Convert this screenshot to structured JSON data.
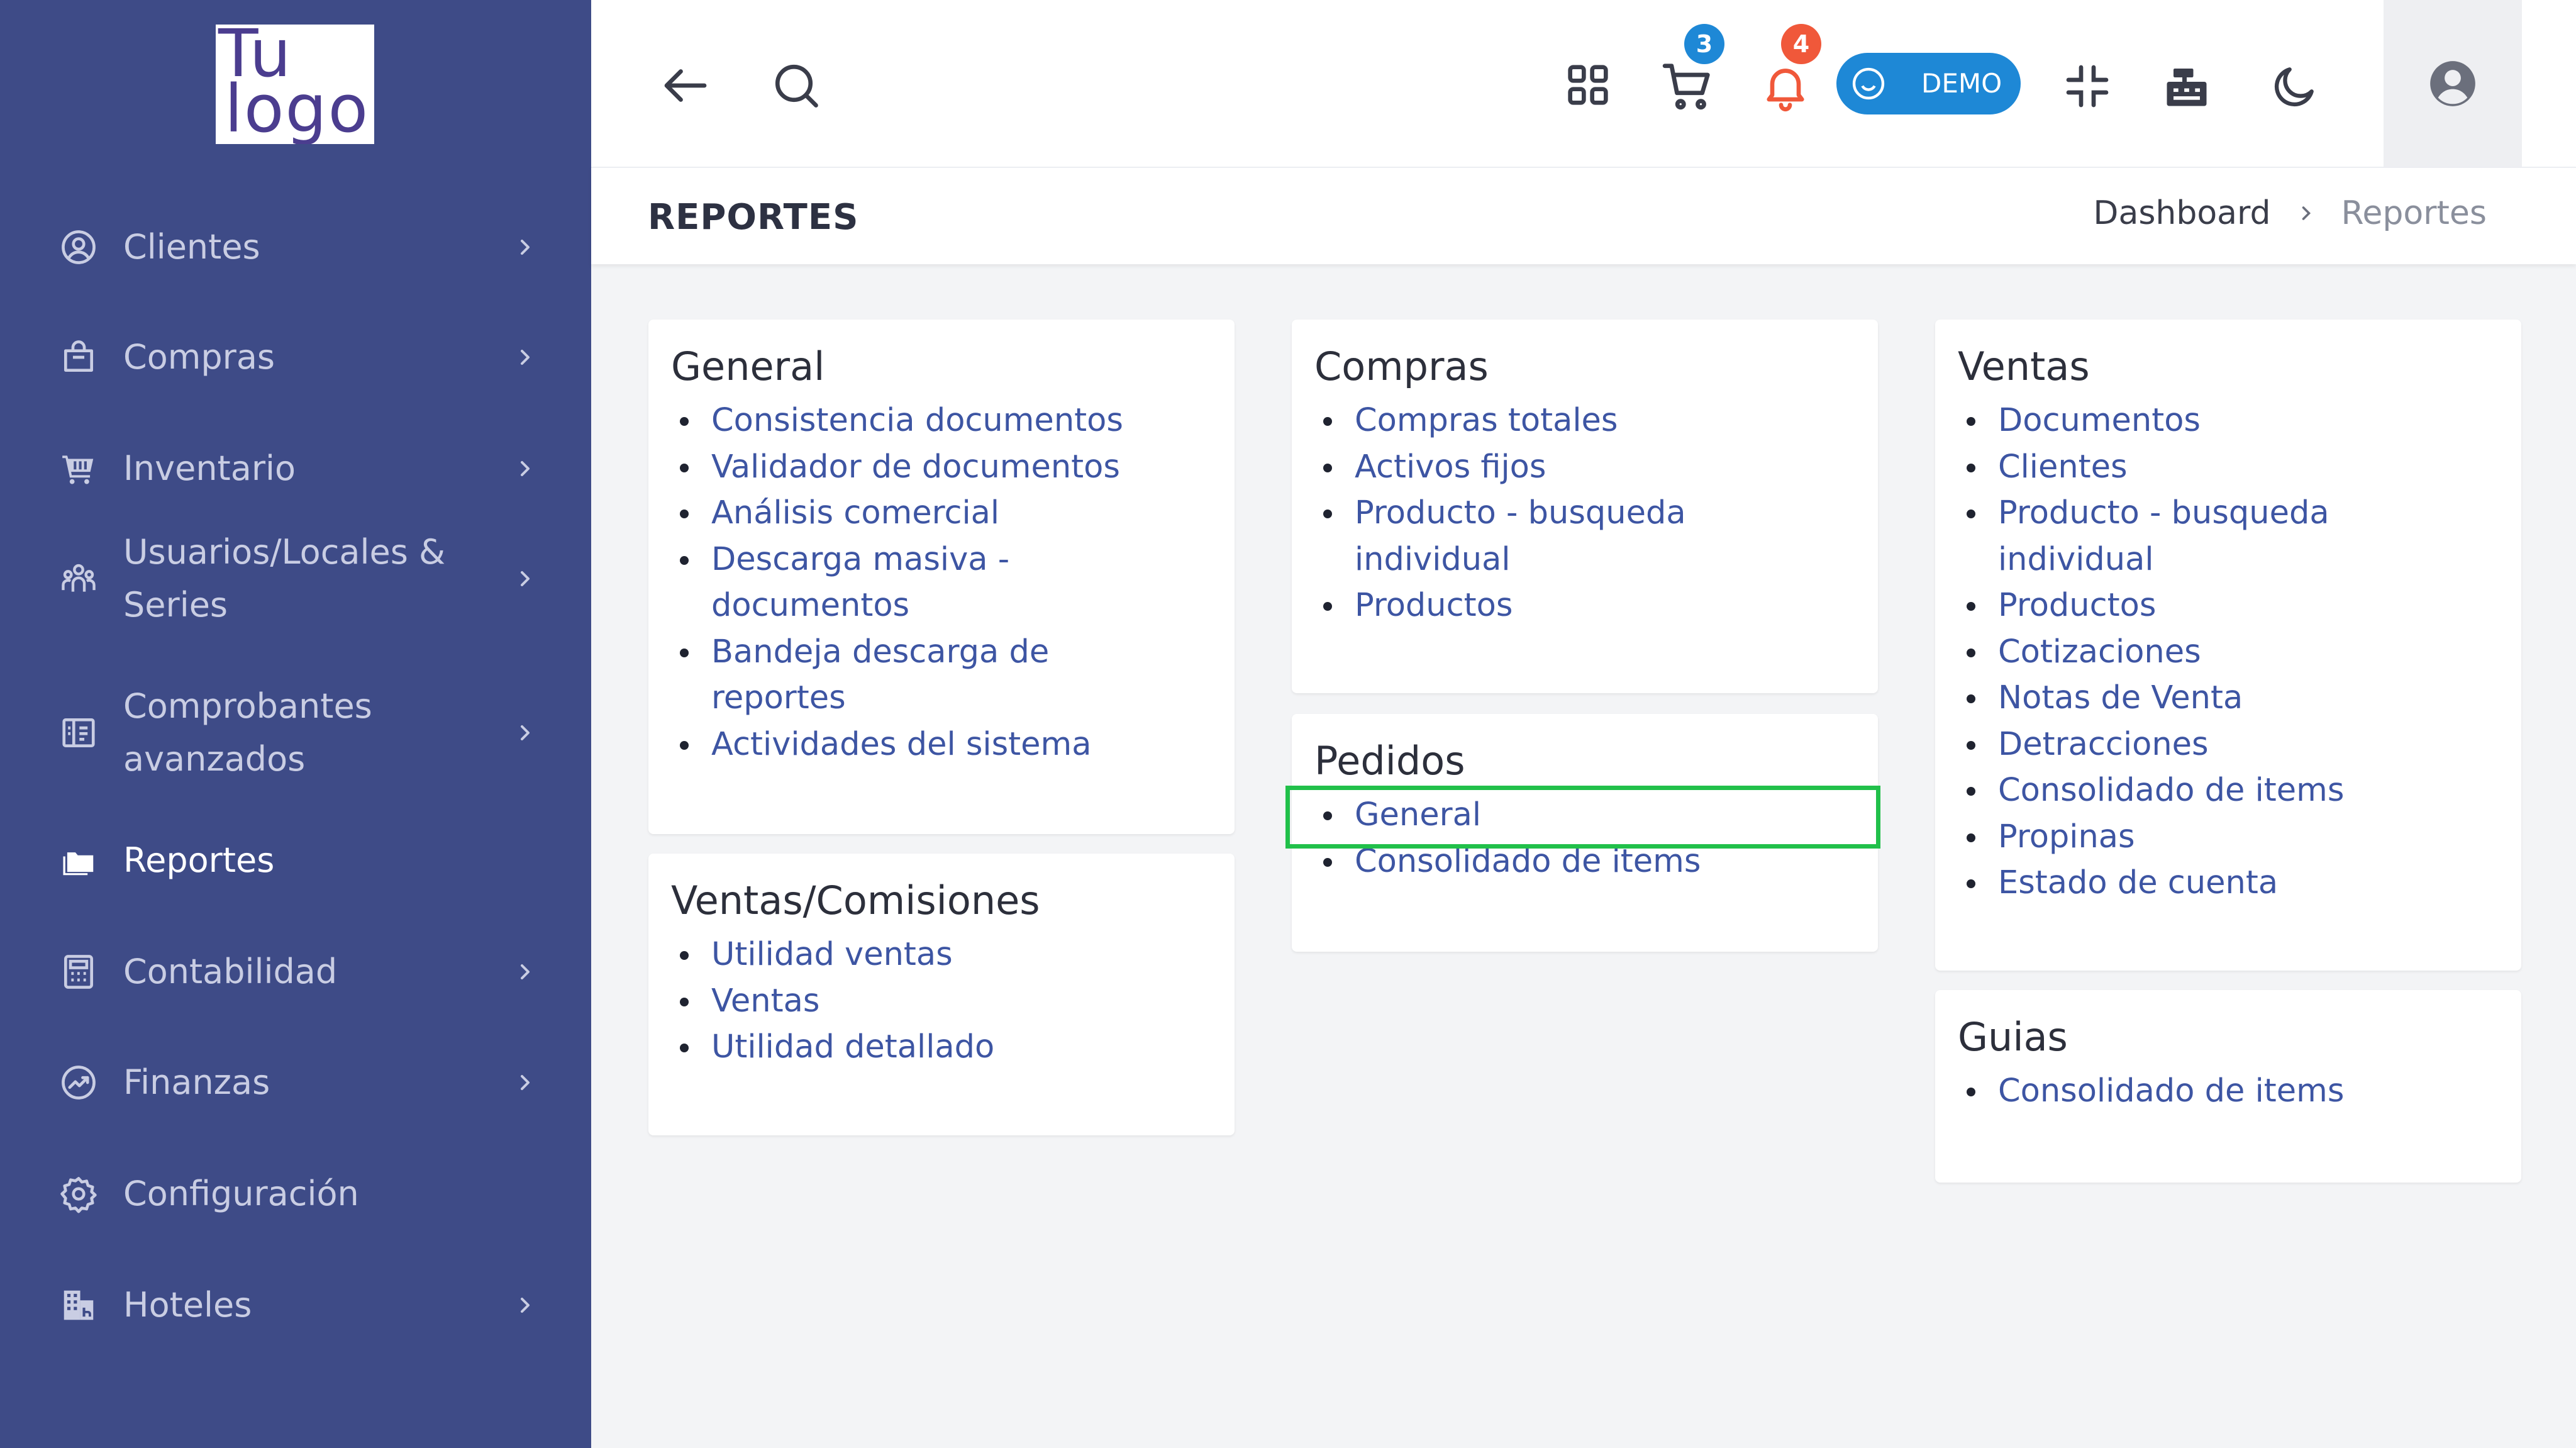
{
  "logo": {
    "line1": "Tu",
    "line2": "logo"
  },
  "sidebar": {
    "items": [
      {
        "label": "Clientes",
        "icon": "user-circle-icon",
        "chevron": true
      },
      {
        "label": "Compras",
        "icon": "shopping-bag-icon",
        "chevron": true
      },
      {
        "label": "Inventario",
        "icon": "cart-building-icon",
        "chevron": true
      },
      {
        "label": "Usuarios/Locales &\nSeries",
        "icon": "users-icon",
        "chevron": true
      },
      {
        "label": "Comprobantes\navanzados",
        "icon": "receipt-icon",
        "chevron": true
      },
      {
        "label": "Reportes",
        "icon": "folders-icon",
        "chevron": false,
        "active": true
      },
      {
        "label": "Contabilidad",
        "icon": "calculator-icon",
        "chevron": true
      },
      {
        "label": "Finanzas",
        "icon": "chart-circle-icon",
        "chevron": true
      },
      {
        "label": "Configuración",
        "icon": "gear-icon",
        "chevron": false
      },
      {
        "label": "Hoteles",
        "icon": "hotel-icon",
        "chevron": true
      }
    ]
  },
  "topbar": {
    "cart_badge": "3",
    "notif_badge": "4",
    "demo_label": "DEMO",
    "colors": {
      "demo": "#1e88d6",
      "cart_badge": "#1e88d6",
      "notif_badge": "#f0583a",
      "notif_icon": "#f0583a"
    }
  },
  "page": {
    "title": "REPORTES",
    "breadcrumb": {
      "home": "Dashboard",
      "current": "Reportes"
    }
  },
  "cards": {
    "general": {
      "title": "General",
      "items": [
        "Consistencia documentos",
        "Validador de documentos",
        "Análisis comercial",
        "Descarga masiva -\ndocumentos",
        "Bandeja descarga de\nreportes",
        "Actividades del sistema"
      ]
    },
    "ventas_comisiones": {
      "title": "Ventas/Comisiones",
      "items": [
        "Utilidad ventas",
        "Ventas",
        "Utilidad detallado"
      ]
    },
    "compras": {
      "title": "Compras",
      "items": [
        "Compras totales",
        "Activos fijos",
        "Producto - busqueda\nindividual",
        "Productos"
      ]
    },
    "pedidos": {
      "title": "Pedidos",
      "items": [
        "General",
        "Consolidado de items"
      ]
    },
    "ventas": {
      "title": "Ventas",
      "items": [
        "Documentos",
        "Clientes",
        "Producto - busqueda\nindividual",
        "Productos",
        "Cotizaciones",
        "Notas de Venta",
        "Detracciones",
        "Consolidado de items",
        "Propinas",
        "Estado de cuenta"
      ]
    },
    "guias": {
      "title": "Guias",
      "items": [
        "Consolidado de items"
      ]
    }
  },
  "accent": {
    "sidebar_bg": "#3e4b87",
    "link": "#3d55a3",
    "highlight": "#21c04a"
  }
}
